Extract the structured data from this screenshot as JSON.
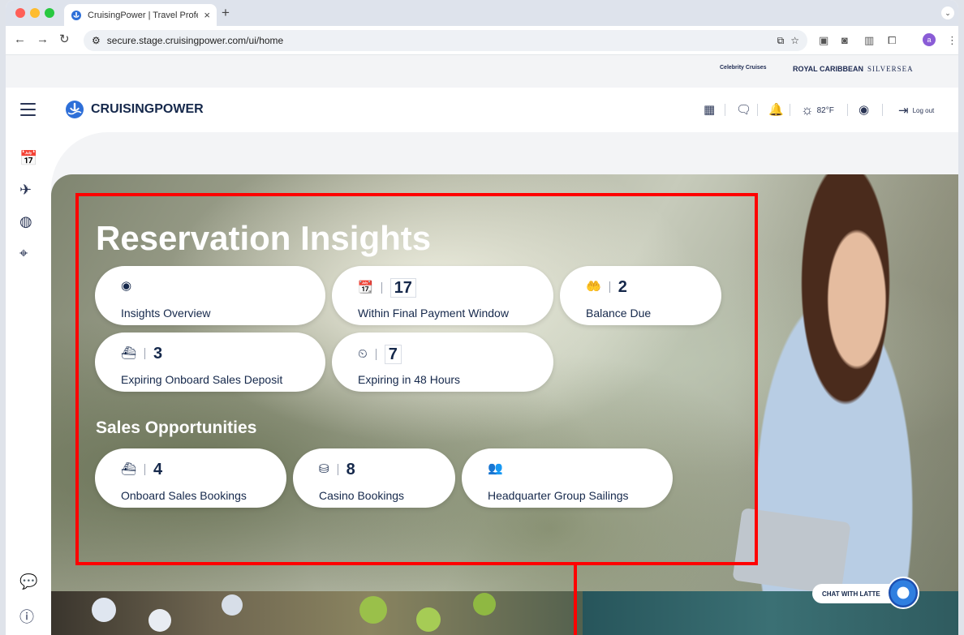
{
  "browser": {
    "tab_title": "CruisingPower | Travel Profes",
    "url": "secure.stage.cruisingpower.com/ui/home",
    "profile_initial": "a"
  },
  "brands": [
    "Celebrity Cruises",
    "ROYAL CARIBBEAN",
    "SILVERSEA"
  ],
  "header": {
    "logo_text": "CRUISINGPOWER",
    "temperature": "82°F",
    "logout_label": "Log out"
  },
  "insights": {
    "title": "Reservation Insights",
    "cards": [
      {
        "icon": "eye-icon",
        "count": "",
        "label": "Insights Overview"
      },
      {
        "icon": "calendar-star-icon",
        "count": "17",
        "label": "Within Final Payment Window"
      },
      {
        "icon": "hand-coin-icon",
        "count": "2",
        "label": "Balance Due"
      },
      {
        "icon": "ship-deposit-icon",
        "count": "3",
        "label": "Expiring Onboard Sales Deposit"
      },
      {
        "icon": "clock-icon",
        "count": "7",
        "label": "Expiring in 48 Hours"
      }
    ]
  },
  "sales": {
    "title": "Sales Opportunities",
    "cards": [
      {
        "icon": "ship-icon",
        "count": "4",
        "label": "Onboard Sales Bookings"
      },
      {
        "icon": "coins-icon",
        "count": "8",
        "label": "Casino Bookings"
      },
      {
        "icon": "group-icon",
        "count": "",
        "label": "Headquarter Group Sailings"
      }
    ]
  },
  "chat": {
    "label": "CHAT WITH LATTE"
  },
  "colors": {
    "navy": "#15284b",
    "highlight": "#ff0000"
  }
}
